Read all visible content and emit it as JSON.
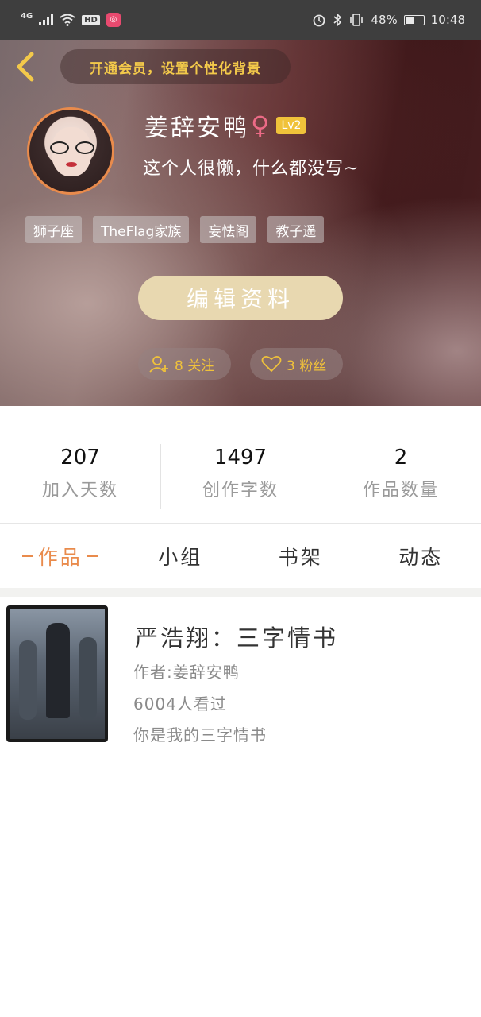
{
  "status_bar": {
    "network": "4G",
    "hd_label": "HD",
    "battery": "48%",
    "time": "10:48"
  },
  "header": {
    "vip_prompt": "开通会员，设置个性化背景",
    "username": "姜辞安鸭",
    "gender_symbol": "♀",
    "level": "Lv2",
    "bio": "这个人很懒，什么都没写~",
    "tags": [
      "狮子座",
      "TheFlag家族",
      "妄怯阁",
      "教子遥"
    ],
    "edit_button": "编辑资料",
    "following": "8 关注",
    "followers": "3 粉丝"
  },
  "stats": [
    {
      "value": "207",
      "label": "加入天数"
    },
    {
      "value": "1497",
      "label": "创作字数"
    },
    {
      "value": "2",
      "label": "作品数量"
    }
  ],
  "tabs": [
    {
      "label": "作品",
      "active": true
    },
    {
      "label": "小组",
      "active": false
    },
    {
      "label": "书架",
      "active": false
    },
    {
      "label": "动态",
      "active": false
    }
  ],
  "works": [
    {
      "title": "严浩翔：三字情书",
      "author": "作者:姜辞安鸭",
      "views": "6004人看过",
      "description": "你是我的三字情书"
    }
  ],
  "colors": {
    "accent_orange": "#e98b4c",
    "gold": "#f0c23a",
    "edit_button_bg": "#e8d8b0",
    "status_bar_bg": "#3e3e3e"
  }
}
